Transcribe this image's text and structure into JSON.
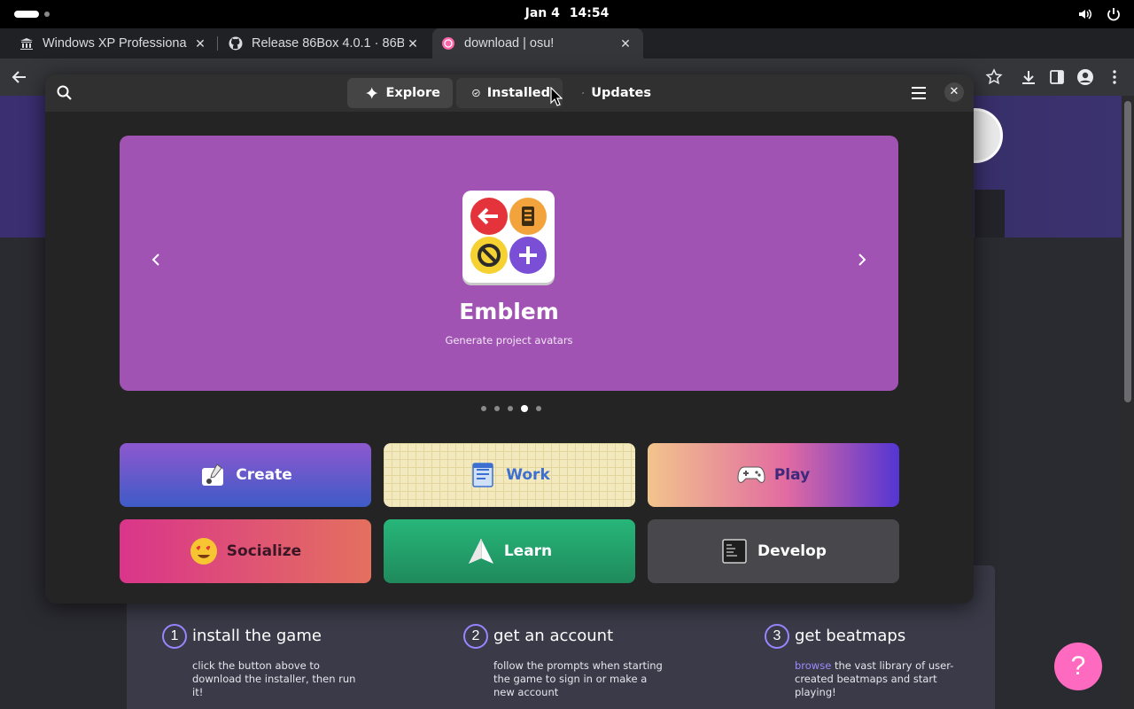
{
  "topbar": {
    "date": "Jan 4",
    "time": "14:54",
    "icons": [
      "activities-indicator",
      "volume-icon",
      "power-icon"
    ]
  },
  "browser": {
    "tabs": [
      {
        "title": "Windows XP Professiona",
        "icon": "archive-icon",
        "active": false
      },
      {
        "title": "Release 86Box 4.0.1 · 86B",
        "icon": "github-icon",
        "active": false
      },
      {
        "title": "download | osu!",
        "icon": "osu-icon",
        "active": true
      }
    ],
    "new_tab": "+",
    "toolbar_icons": [
      "back-icon",
      "bookmark-star-icon",
      "download-icon",
      "side-panel-icon",
      "profile-icon",
      "kebab-menu-icon"
    ]
  },
  "software": {
    "views": [
      {
        "label": "Explore",
        "icon": "star-sparkle-icon",
        "state": "selected"
      },
      {
        "label": "Installed",
        "icon": "check-circle-icon",
        "state": "hover"
      },
      {
        "label": "Updates",
        "icon": "refresh-icon",
        "state": "normal"
      }
    ],
    "featured": {
      "name": "Emblem",
      "description": "Generate project avatars",
      "background": "#a153b4",
      "page_index": 3,
      "page_count": 5
    },
    "categories": [
      {
        "label": "Create",
        "icon": "create-icon",
        "style": "create"
      },
      {
        "label": "Work",
        "icon": "work-icon",
        "style": "work"
      },
      {
        "label": "Play",
        "icon": "gamepad-icon",
        "style": "play"
      },
      {
        "label": "Socialize",
        "icon": "heart-eyes-emoji-icon",
        "style": "socialize"
      },
      {
        "label": "Learn",
        "icon": "paper-plane-icon",
        "style": "learn"
      },
      {
        "label": "Develop",
        "icon": "terminal-icon",
        "style": "develop"
      }
    ]
  },
  "osu_page": {
    "steps": [
      {
        "number": "1",
        "title": "install the game",
        "desc": "click the button above to download the installer, then run it!",
        "link": ""
      },
      {
        "number": "2",
        "title": "get an account",
        "desc": "follow the prompts when starting the game to sign in or make a new account",
        "link": ""
      },
      {
        "number": "3",
        "title": "get beatmaps",
        "desc": " the vast library of user-created beatmaps and start playing!",
        "link": "browse"
      }
    ],
    "help_label": "?"
  },
  "colors": {
    "accent_purple": "#a153b4",
    "osu_pink": "#ff6ac1",
    "step_ring": "#9a85ff"
  }
}
